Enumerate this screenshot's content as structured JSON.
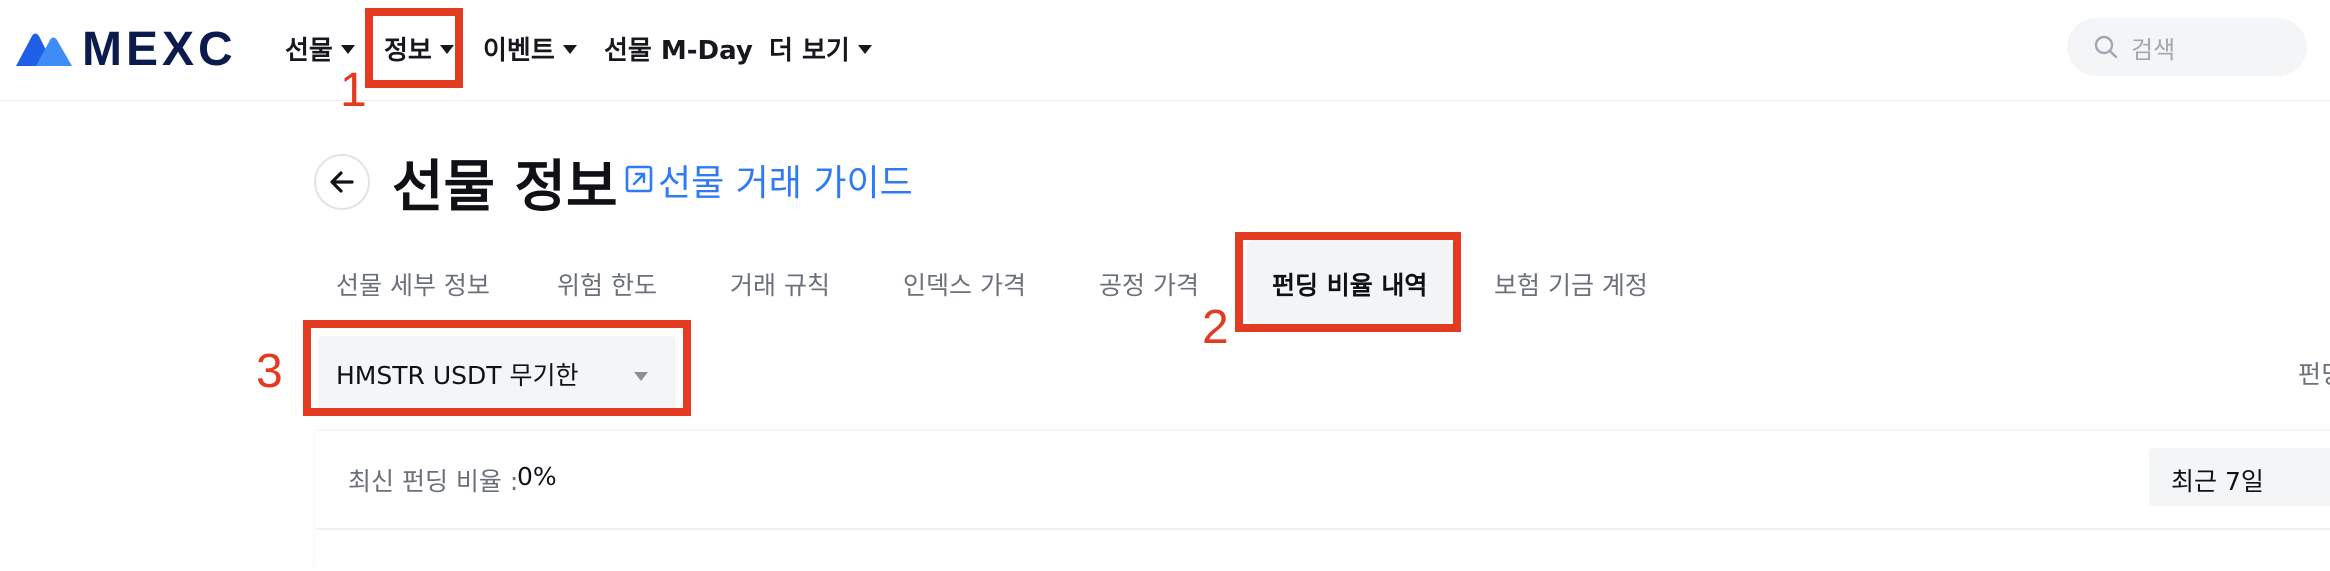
{
  "brand": {
    "name": "MEXC",
    "color": "#0b1b4d",
    "accent": "#2f7bf5"
  },
  "nav": {
    "items": [
      {
        "label": "선물",
        "dropdown": true
      },
      {
        "label": "정보",
        "dropdown": true
      },
      {
        "label": "이벤트",
        "dropdown": true
      },
      {
        "label": "선물 M-Day",
        "dropdown": false
      },
      {
        "label": "더 보기",
        "dropdown": true
      }
    ]
  },
  "search": {
    "placeholder": "검색",
    "icon": "search-icon"
  },
  "annotations": {
    "color": "#e33b22",
    "labels": [
      "1",
      "2",
      "3"
    ]
  },
  "page": {
    "title": "선물 정보",
    "guide_link": "선물 거래 가이드",
    "back_icon": "arrow-left-icon"
  },
  "tabs": [
    {
      "label": "선물 세부 정보",
      "active": false
    },
    {
      "label": "위험 한도",
      "active": false
    },
    {
      "label": "거래 규칙",
      "active": false
    },
    {
      "label": "인덱스 가격",
      "active": false
    },
    {
      "label": "공정 가격",
      "active": false
    },
    {
      "label": "펀딩 비율 내역",
      "active": true
    },
    {
      "label": "보험 기금 계정",
      "active": false
    }
  ],
  "symbol_select": {
    "value": "HMSTR USDT 무기한"
  },
  "right_clipped_text": "펀딩",
  "funding": {
    "latest_label": "최신 펀딩 비율 :",
    "latest_value": "0%",
    "period": "최근 7일"
  }
}
